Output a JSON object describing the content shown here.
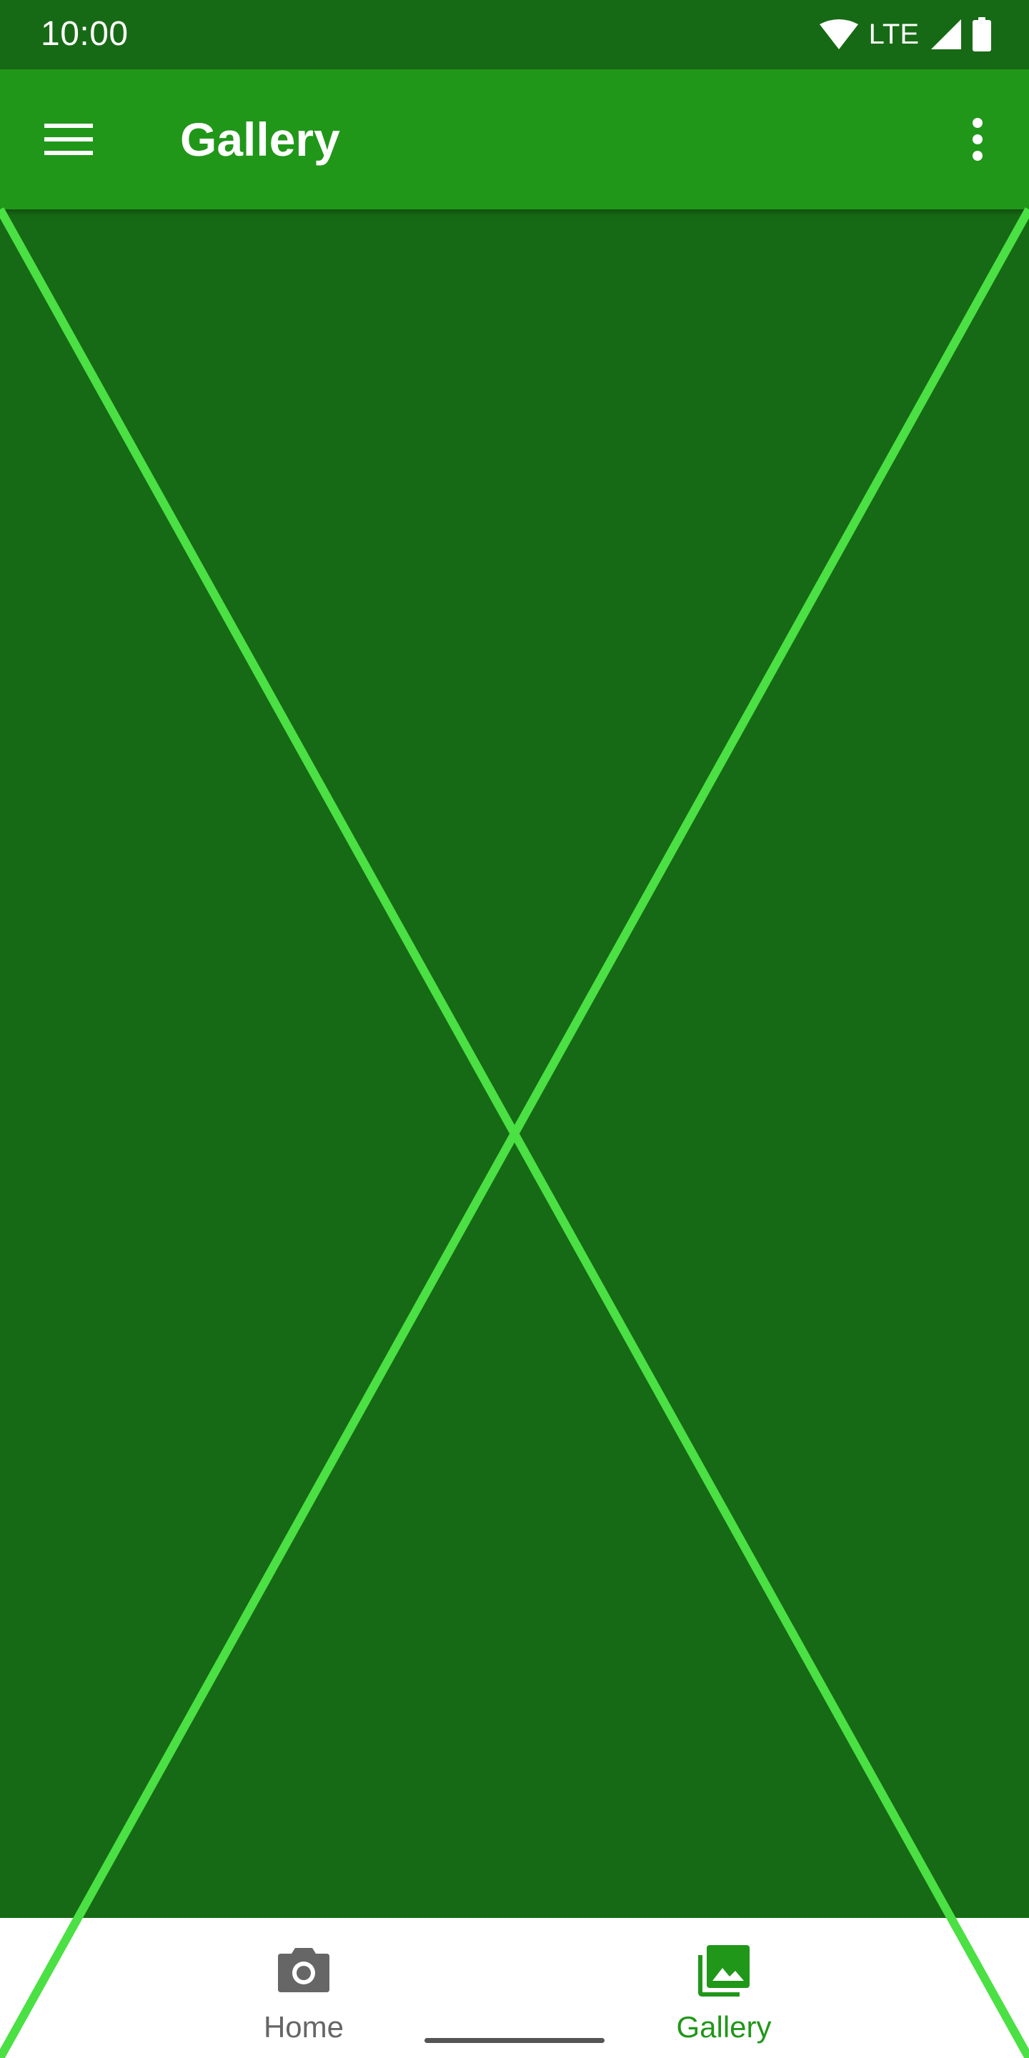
{
  "status_bar": {
    "time": "10:00",
    "network": "LTE",
    "icons": [
      "wifi-icon",
      "cell-signal-icon",
      "battery-icon"
    ]
  },
  "app_bar": {
    "title": "Gallery",
    "icons": [
      "menu-icon",
      "more-vert-icon"
    ]
  },
  "bottom_nav": {
    "items": [
      {
        "label": "Home",
        "icon": "camera-icon",
        "selected": false
      },
      {
        "label": "Gallery",
        "icon": "photo-library-icon",
        "selected": true
      }
    ]
  },
  "colors": {
    "status_bar": "#176a15",
    "app_bar": "#209719",
    "content_background": "#176a15",
    "diagonal_lines": "#4be044",
    "nav_selected": "#209719",
    "nav_unselected": "#666666"
  }
}
